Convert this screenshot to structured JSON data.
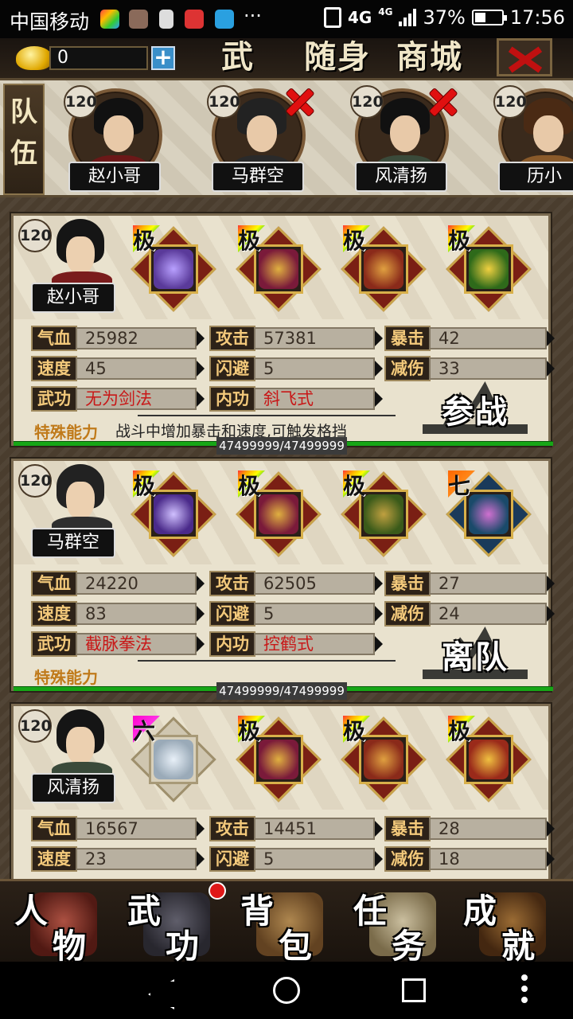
{
  "status_bar": {
    "carrier": "中国移动",
    "network": "4G",
    "network_small": "4G",
    "battery": "37%",
    "time": "17:56",
    "more": "···"
  },
  "top_bar": {
    "gold": "0",
    "plus": "+",
    "tabs": [
      "武",
      "随身",
      "商城"
    ]
  },
  "team": {
    "label_1": "队",
    "label_2": "伍",
    "members": [
      {
        "level": "120",
        "name": "赵小哥",
        "removable": false
      },
      {
        "level": "120",
        "name": "马群空",
        "removable": true
      },
      {
        "level": "120",
        "name": "风清扬",
        "removable": true
      },
      {
        "level": "120",
        "name": "历小",
        "removable": false
      }
    ]
  },
  "heroes": [
    {
      "level": "120",
      "name": "赵小哥",
      "equipment": [
        {
          "grade": "极",
          "item": "sword-icon",
          "color": "#5a3a9a"
        },
        {
          "grade": "极",
          "item": "armor-icon",
          "color": "#7a1a3a"
        },
        {
          "grade": "极",
          "item": "boots-icon",
          "color": "#8a2a1a"
        },
        {
          "grade": "极",
          "item": "ring-icon",
          "color": "#2e6a1a"
        }
      ],
      "stats": {
        "hp_label": "气血",
        "hp": "25982",
        "atk_label": "攻击",
        "atk": "57381",
        "crit_label": "暴击",
        "crit": "42",
        "spd_label": "速度",
        "spd": "45",
        "dodge_label": "闪避",
        "dodge": "5",
        "dmgred_label": "减伤",
        "dmgred": "33",
        "martial_label": "武功",
        "martial": "无为剑法",
        "inner_label": "内功",
        "inner": "斜飞式"
      },
      "special_label": "特殊能力",
      "special": "战斗中增加暴击和速度,可触发格挡",
      "action": "参战",
      "hp_text": "47499999/47499999"
    },
    {
      "level": "120",
      "name": "马群空",
      "equipment": [
        {
          "grade": "极",
          "item": "blade-icon",
          "color": "#4a2a8a"
        },
        {
          "grade": "极",
          "item": "armor-icon",
          "color": "#7a1a3a"
        },
        {
          "grade": "极",
          "item": "boots-icon",
          "color": "#3a5a1a"
        },
        {
          "grade": "七",
          "item": "bracelet-icon",
          "color": "#1a4a6a"
        }
      ],
      "stats": {
        "hp_label": "气血",
        "hp": "24220",
        "atk_label": "攻击",
        "atk": "62505",
        "crit_label": "暴击",
        "crit": "27",
        "spd_label": "速度",
        "spd": "83",
        "dodge_label": "闪避",
        "dodge": "5",
        "dmgred_label": "减伤",
        "dmgred": "24",
        "martial_label": "武功",
        "martial": "截脉拳法",
        "inner_label": "内功",
        "inner": "控鹤式"
      },
      "special_label": "特殊能力",
      "special": "",
      "action": "离队",
      "hp_text": "47499999/47499999"
    },
    {
      "level": "120",
      "name": "风清扬",
      "equipment": [
        {
          "grade": "六",
          "item": "sword-icon",
          "color": "#9aaab8"
        },
        {
          "grade": "极",
          "item": "armor-icon",
          "color": "#7a1a3a"
        },
        {
          "grade": "极",
          "item": "boots-icon",
          "color": "#8a2a1a"
        },
        {
          "grade": "极",
          "item": "token-icon",
          "color": "#9a2a1a"
        }
      ],
      "stats": {
        "hp_label": "气血",
        "hp": "16567",
        "atk_label": "攻击",
        "atk": "14451",
        "crit_label": "暴击",
        "crit": "28",
        "spd_label": "速度",
        "spd": "23",
        "dodge_label": "闪避",
        "dodge": "5",
        "dmgred_label": "减伤",
        "dmgred": "18"
      }
    }
  ],
  "bottom_nav": [
    {
      "t1": "人",
      "t2": "物"
    },
    {
      "t1": "武",
      "t2": "功"
    },
    {
      "t1": "背",
      "t2": "包"
    },
    {
      "t1": "任",
      "t2": "务"
    },
    {
      "t1": "成",
      "t2": "就"
    }
  ]
}
